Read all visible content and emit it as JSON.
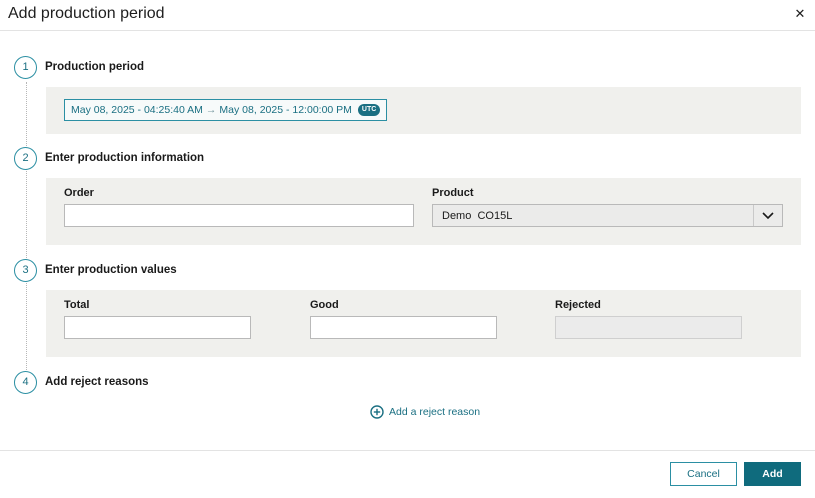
{
  "dialog": {
    "title": "Add production period",
    "close_icon": "close-icon"
  },
  "steps": {
    "period": {
      "number": "1",
      "title": "Production period",
      "start": "May 08, 2025 - 04:25:40 AM",
      "arrow": "→",
      "end": "May 08, 2025 - 12:00:00 PM",
      "timezone": "UTC"
    },
    "info": {
      "number": "2",
      "title": "Enter production information",
      "order_label": "Order",
      "order_value": "",
      "product_label": "Product",
      "product_value": "Demo  CO15L"
    },
    "values": {
      "number": "3",
      "title": "Enter production values",
      "total_label": "Total",
      "total_value": "",
      "good_label": "Good",
      "good_value": "",
      "rejected_label": "Rejected",
      "rejected_value": ""
    },
    "reject": {
      "number": "4",
      "title": "Add reject reasons",
      "add_link": "Add a reject reason",
      "add_icon": "plus-circle-icon"
    }
  },
  "footer": {
    "cancel_label": "Cancel",
    "add_label": "Add"
  },
  "colors": {
    "accent": "#1a6f82",
    "accent_light": "#2b8fa3",
    "primary_button": "#0f6b7d",
    "panel_bg": "#f0f0ed"
  }
}
